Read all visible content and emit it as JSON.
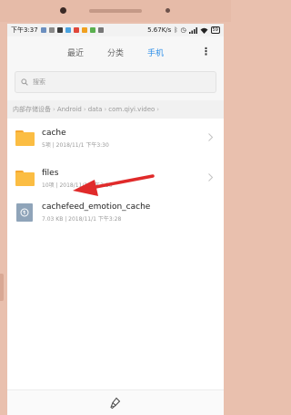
{
  "status": {
    "time": "下午3:37",
    "speed": "5.67K/s",
    "battery": "59"
  },
  "tabs": [
    {
      "label": "最近",
      "active": false
    },
    {
      "label": "分类",
      "active": false
    },
    {
      "label": "手机",
      "active": true
    }
  ],
  "more_label": "⋮",
  "search": {
    "placeholder": "搜索"
  },
  "breadcrumb": [
    "内部存储设备",
    "Android",
    "data",
    "com.qiyi.video"
  ],
  "files": [
    {
      "name": "cache",
      "meta": "5项 | 2018/11/1 下午3:30",
      "type": "folder"
    },
    {
      "name": "files",
      "meta": "10项 | 2018/11/1 下午3:30",
      "type": "folder"
    },
    {
      "name": "cachefeed_emotion_cache",
      "meta": "7.03 KB | 2018/11/1 下午3:28",
      "type": "file"
    }
  ],
  "colors": {
    "accent": "#2c8ee8",
    "folder": "#fbbd43",
    "arrow": "#e02a2a"
  },
  "icons": {
    "search": "search-icon",
    "chevron": "chevron-right-icon",
    "clean": "clean-brush-icon"
  }
}
